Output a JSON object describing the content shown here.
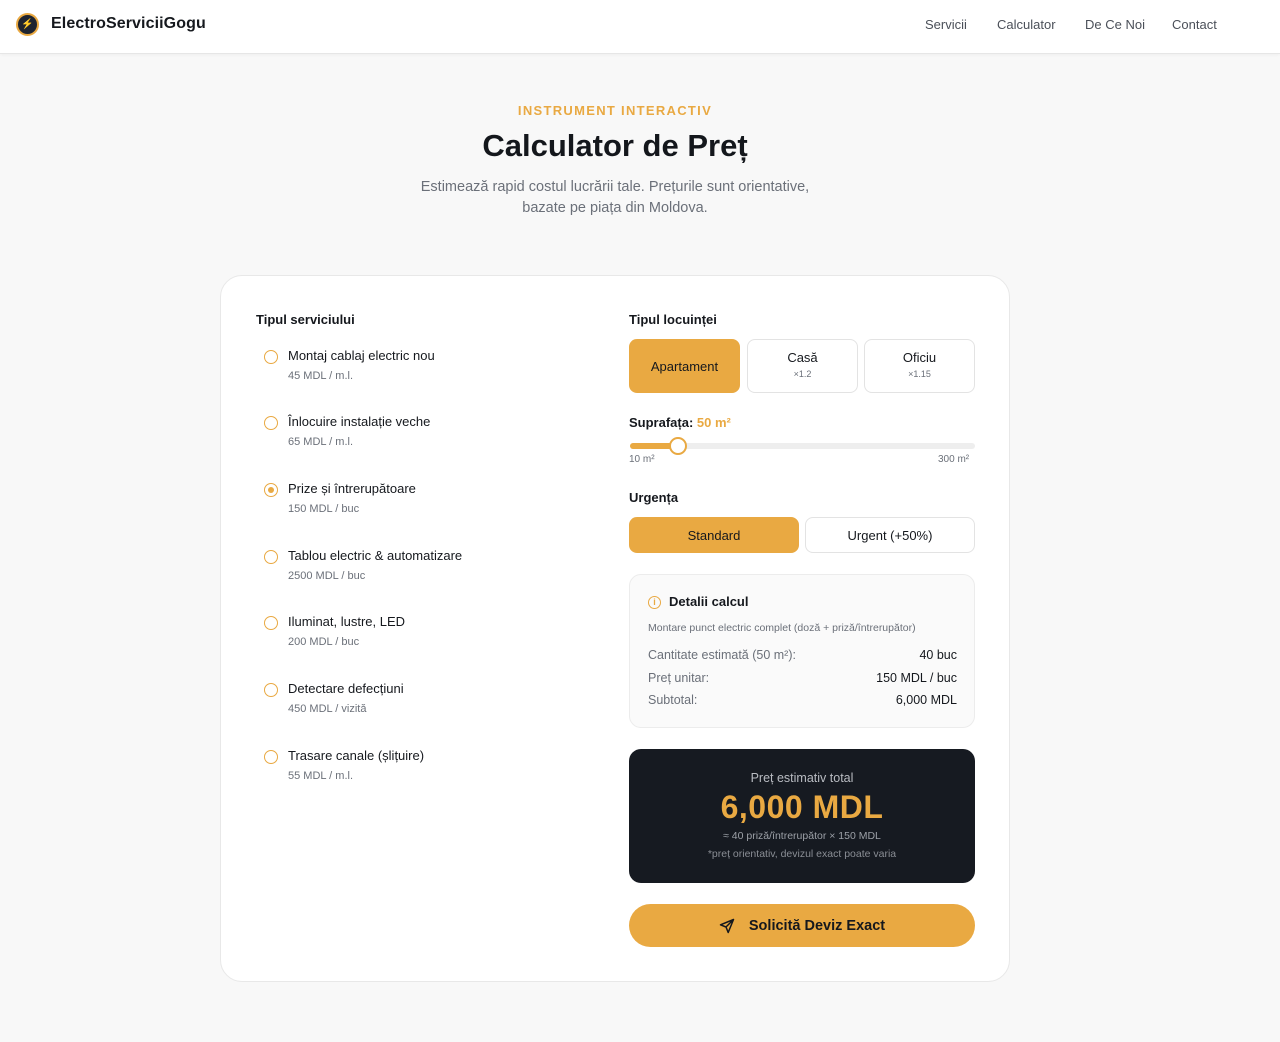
{
  "header": {
    "brand": "ElectroServiciiGogu",
    "nav": [
      "Servicii",
      "Calculator",
      "De Ce Noi",
      "Contact"
    ]
  },
  "hero": {
    "eyebrow": "INSTRUMENT INTERACTIV",
    "title": "Calculator de Preț",
    "subtitle": "Estimează rapid costul lucrării tale. Prețurile sunt orientative, bazate pe piața din Moldova."
  },
  "services": {
    "label": "Tipul serviciului",
    "selected_index": 2,
    "items": [
      {
        "name": "Montaj cablaj electric nou",
        "price": "45 MDL / m.l."
      },
      {
        "name": "Înlocuire instalație veche",
        "price": "65 MDL / m.l."
      },
      {
        "name": "Prize și întrerupătoare",
        "price": "150 MDL / buc"
      },
      {
        "name": "Tablou electric & automatizare",
        "price": "2500 MDL / buc"
      },
      {
        "name": "Iluminat, lustre, LED",
        "price": "200 MDL / buc"
      },
      {
        "name": "Detectare defecțiuni",
        "price": "450 MDL / vizită"
      },
      {
        "name": "Trasare canale (șlițuire)",
        "price": "55 MDL / m.l."
      }
    ]
  },
  "home_type": {
    "label": "Tipul locuinței",
    "options": [
      {
        "label": "Apartament",
        "multiplier": ""
      },
      {
        "label": "Casă",
        "multiplier": "×1.2"
      },
      {
        "label": "Oficiu",
        "multiplier": "×1.15"
      }
    ],
    "selected_index": 0
  },
  "surface": {
    "label": "Suprafața:",
    "value_text": "50 m²",
    "value": 50,
    "min": 10,
    "max": 300,
    "min_label": "10 m²",
    "max_label": "300 m²"
  },
  "urgency": {
    "label": "Urgența",
    "options": [
      "Standard",
      "Urgent (+50%)"
    ],
    "selected_index": 0
  },
  "details": {
    "title": "Detalii calcul",
    "description": "Montare punct electric complet (doză + priză/întrerupător)",
    "rows": [
      {
        "key": "Cantitate estimată (50 m²):",
        "value": "40 buc"
      },
      {
        "key": "Preț unitar:",
        "value": "150 MDL / buc"
      },
      {
        "key": "Subtotal:",
        "value": "6,000 MDL"
      }
    ]
  },
  "total": {
    "label": "Preț estimativ total",
    "value": "6,000 MDL",
    "formula": "≈ 40 priză/întrerupător × 150 MDL",
    "note": "*preț orientativ, devizul exact poate varia"
  },
  "cta": {
    "label": "Solicită Deviz Exact",
    "icon": "send-icon"
  },
  "colors": {
    "accent": "#e9a942",
    "dark": "#161a21",
    "background": "#f8f8f8"
  }
}
